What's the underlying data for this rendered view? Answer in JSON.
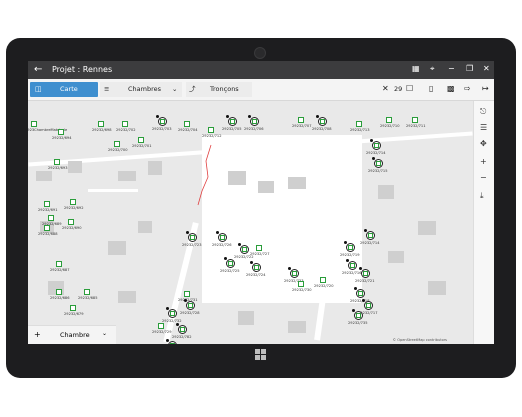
{
  "titlebar": {
    "back_icon": "arrow-left-icon",
    "title": "Projet : Rennes",
    "icons": [
      "grid-icon",
      "gps-icon",
      "minimize-icon",
      "restore-icon",
      "close-icon"
    ]
  },
  "toolbar": {
    "carte_label": "Carte",
    "chambres_label": "Chambres",
    "troncons_label": "Tronçons",
    "count": "29",
    "icons": [
      "close-icon",
      "checkbox-icon",
      "document-icon",
      "document-download-icon",
      "export-icon",
      "logout-icon"
    ]
  },
  "right_panel": {
    "icons": [
      "route-icon",
      "layers-icon",
      "measure-icon",
      "zoom-in-icon",
      "zoom-out-icon",
      "download-icon"
    ],
    "zoom_in": "+",
    "zoom_out": "−"
  },
  "bottom": {
    "add_label": "+",
    "select_label": "Chambre"
  },
  "map": {
    "attribution": "© OpenStreetMap contributors",
    "markers": [
      {
        "label": "2923ChambreMatricule",
        "ring": false
      },
      {
        "label": "29232/698",
        "ring": false
      },
      {
        "label": "29232/702",
        "ring": false
      },
      {
        "label": "29232/694",
        "ring": false
      },
      {
        "label": "29232/703",
        "ring": true
      },
      {
        "label": "29232/704",
        "ring": false
      },
      {
        "label": "29232/701",
        "ring": false
      },
      {
        "label": "29232/700",
        "ring": false
      },
      {
        "label": "29232/712",
        "ring": false
      },
      {
        "label": "29232/705",
        "ring": true
      },
      {
        "label": "29232/706",
        "ring": true
      },
      {
        "label": "29232/707",
        "ring": false
      },
      {
        "label": "29232/708",
        "ring": true
      },
      {
        "label": "29232/713",
        "ring": false
      },
      {
        "label": "29232/710",
        "ring": false
      },
      {
        "label": "29232/711",
        "ring": false
      },
      {
        "label": "29232/714",
        "ring": true
      },
      {
        "label": "29232/715",
        "ring": true
      },
      {
        "label": "29232/693",
        "ring": false
      },
      {
        "label": "29232/692",
        "ring": false
      },
      {
        "label": "29232/691",
        "ring": false
      },
      {
        "label": "29232/689",
        "ring": false
      },
      {
        "label": "29232/690",
        "ring": false
      },
      {
        "label": "29232/688",
        "ring": false
      },
      {
        "label": "29232/687",
        "ring": false
      },
      {
        "label": "29232/686",
        "ring": false
      },
      {
        "label": "29232/685",
        "ring": false
      },
      {
        "label": "29232/679",
        "ring": false
      },
      {
        "label": "29232/723",
        "ring": true
      },
      {
        "label": "29232/726",
        "ring": true
      },
      {
        "label": "29232/722",
        "ring": true
      },
      {
        "label": "29232/727",
        "ring": false
      },
      {
        "label": "29232/725",
        "ring": true
      },
      {
        "label": "29232/724",
        "ring": true
      },
      {
        "label": "29232/720",
        "ring": false
      },
      {
        "label": "29232/719",
        "ring": true
      },
      {
        "label": "29232/716",
        "ring": true
      },
      {
        "label": "29232/721",
        "ring": true
      },
      {
        "label": "29232/733",
        "ring": true
      },
      {
        "label": "29232/714",
        "ring": true
      },
      {
        "label": "29232/718",
        "ring": true
      },
      {
        "label": "29232/717",
        "ring": true
      },
      {
        "label": "29232/730",
        "ring": false
      },
      {
        "label": "29232/735",
        "ring": true
      },
      {
        "label": "29232/731",
        "ring": false
      },
      {
        "label": "29232/732",
        "ring": true
      },
      {
        "label": "29232/728",
        "ring": true
      },
      {
        "label": "29232/729",
        "ring": false
      },
      {
        "label": "29232/782",
        "ring": true
      },
      {
        "label": "29232/734",
        "ring": true
      },
      {
        "label": "29232/736",
        "ring": false
      }
    ]
  },
  "colors": {
    "accent": "#3f8fcf",
    "marker_green": "#2a9d3a",
    "route_red": "#e04040"
  }
}
